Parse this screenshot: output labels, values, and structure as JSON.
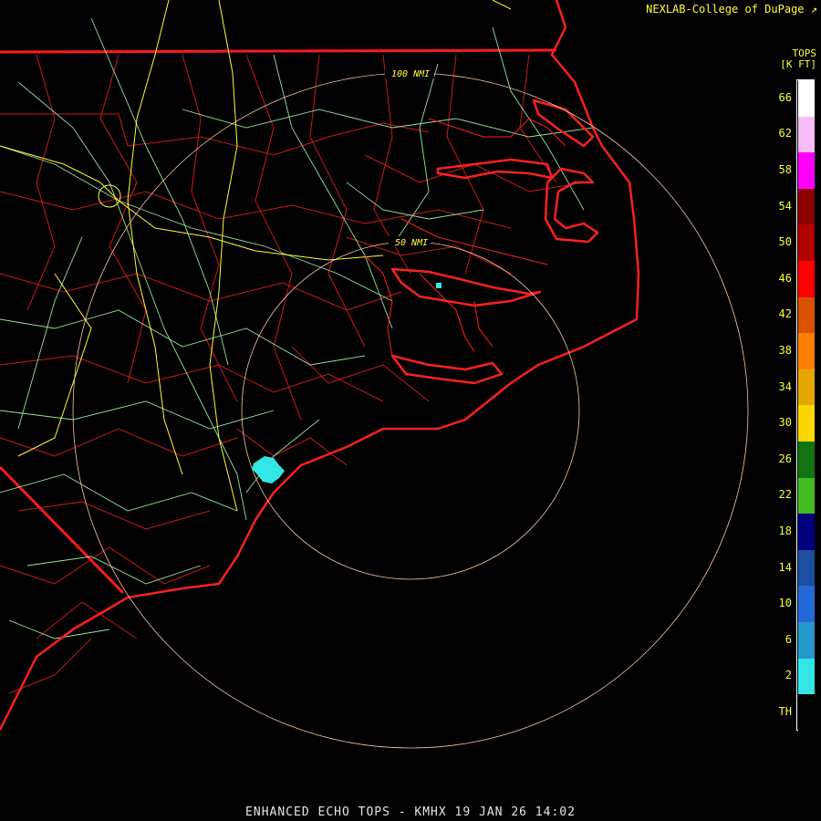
{
  "credit": "NEXLAB-College of DuPage",
  "credit_icon": "cursor-arrow-icon",
  "legend": {
    "title_line1": "TOPS",
    "title_line2": "[K FT]",
    "levels": [
      {
        "label": "66",
        "color": "#ffffff"
      },
      {
        "label": "62",
        "color": "#f7bdf7"
      },
      {
        "label": "58",
        "color": "#ff00ff"
      },
      {
        "label": "54",
        "color": "#8b0000"
      },
      {
        "label": "50",
        "color": "#b00000"
      },
      {
        "label": "46",
        "color": "#ff0000"
      },
      {
        "label": "42",
        "color": "#d95200"
      },
      {
        "label": "38",
        "color": "#ff7f00"
      },
      {
        "label": "34",
        "color": "#e6a600"
      },
      {
        "label": "30",
        "color": "#ffd700"
      },
      {
        "label": "26",
        "color": "#137313"
      },
      {
        "label": "22",
        "color": "#44bb22"
      },
      {
        "label": "18",
        "color": "#00007f"
      },
      {
        "label": "14",
        "color": "#1c4fa0"
      },
      {
        "label": "10",
        "color": "#2368d6"
      },
      {
        "label": "6",
        "color": "#2299cc"
      },
      {
        "label": "2",
        "color": "#33e6e6"
      },
      {
        "label": "TH",
        "color": "#000000"
      }
    ]
  },
  "rings": {
    "inner_label": "50 NMI",
    "outer_label": "100 NMI"
  },
  "footer": "ENHANCED ECHO TOPS - KMHX 19 JAN 26 14:02",
  "colors": {
    "coast": "#ff2020",
    "boundaries": "#d01818",
    "roads": "#9be39b",
    "highways": "#ffff33",
    "rings": "#ffc8a0",
    "echo": "#33e6e6"
  }
}
